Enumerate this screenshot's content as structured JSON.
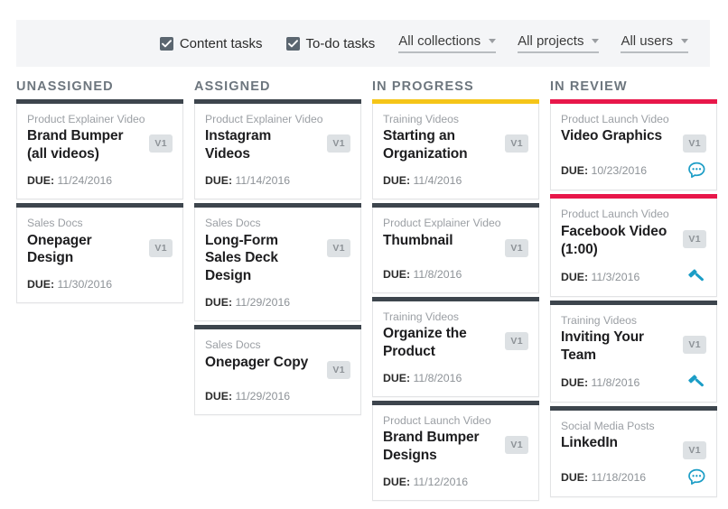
{
  "toolbar": {
    "checkboxes": [
      {
        "label": "Content tasks",
        "checked": true
      },
      {
        "label": "To-do tasks",
        "checked": true
      }
    ],
    "dropdowns": [
      {
        "label": "All collections"
      },
      {
        "label": "All projects"
      },
      {
        "label": "All users"
      }
    ]
  },
  "colors": {
    "accent_slate": "#3d454d",
    "accent_yellow": "#f5c518",
    "accent_red": "#e8174a",
    "icon_teal": "#1b9dc6",
    "badge_bg": "#dde1e4",
    "toolbar_bg": "#f4f5f7"
  },
  "columns": [
    {
      "title": "UNASSIGNED",
      "cards": [
        {
          "collection": "Product Explainer Video",
          "title": "Brand Bumper (all videos)",
          "badge": "V1",
          "due_label": "DUE:",
          "due_date": "11/24/2016",
          "bar_color": "#3d454d",
          "icon": ""
        },
        {
          "collection": "Sales Docs",
          "title": "Onepager Design",
          "badge": "V1",
          "due_label": "DUE:",
          "due_date": "11/30/2016",
          "bar_color": "#3d454d",
          "icon": ""
        }
      ]
    },
    {
      "title": "ASSIGNED",
      "cards": [
        {
          "collection": "Product Explainer Video",
          "title": "Instagram Videos",
          "badge": "V1",
          "due_label": "DUE:",
          "due_date": "11/14/2016",
          "bar_color": "#3d454d",
          "icon": ""
        },
        {
          "collection": "Sales Docs",
          "title": "Long-Form Sales Deck Design",
          "badge": "V1",
          "due_label": "DUE:",
          "due_date": "11/29/2016",
          "bar_color": "#3d454d",
          "icon": ""
        },
        {
          "collection": "Sales Docs",
          "title": "Onepager Copy",
          "badge": "V1",
          "due_label": "DUE:",
          "due_date": "11/29/2016",
          "bar_color": "#3d454d",
          "icon": ""
        }
      ]
    },
    {
      "title": "IN PROGRESS",
      "cards": [
        {
          "collection": "Training Videos",
          "title": "Starting an Organization",
          "badge": "V1",
          "due_label": "DUE:",
          "due_date": "11/4/2016",
          "bar_color": "#f5c518",
          "icon": ""
        },
        {
          "collection": "Product Explainer Video",
          "title": "Thumbnail",
          "badge": "V1",
          "due_label": "DUE:",
          "due_date": "11/8/2016",
          "bar_color": "#3d454d",
          "icon": ""
        },
        {
          "collection": "Training Videos",
          "title": "Organize the Product",
          "badge": "V1",
          "due_label": "DUE:",
          "due_date": "11/8/2016",
          "bar_color": "#3d454d",
          "icon": ""
        },
        {
          "collection": "Product Launch Video",
          "title": "Brand Bumper Designs",
          "badge": "V1",
          "due_label": "DUE:",
          "due_date": "11/12/2016",
          "bar_color": "#3d454d",
          "icon": ""
        }
      ]
    },
    {
      "title": "IN REVIEW",
      "cards": [
        {
          "collection": "Product Launch Video",
          "title": "Video Graphics",
          "badge": "V1",
          "due_label": "DUE:",
          "due_date": "10/23/2016",
          "bar_color": "#e8174a",
          "icon": "comment-icon"
        },
        {
          "collection": "Product Launch Video",
          "title": "Facebook Video (1:00)",
          "badge": "V1",
          "due_label": "DUE:",
          "due_date": "11/3/2016",
          "bar_color": "#e8174a",
          "icon": "gavel-icon"
        },
        {
          "collection": "Training Videos",
          "title": "Inviting Your Team",
          "badge": "V1",
          "due_label": "DUE:",
          "due_date": "11/8/2016",
          "bar_color": "#3d454d",
          "icon": "gavel-icon"
        },
        {
          "collection": "Social Media Posts",
          "title": "LinkedIn",
          "badge": "V1",
          "due_label": "DUE:",
          "due_date": "11/18/2016",
          "bar_color": "#3d454d",
          "icon": "comment-icon"
        }
      ]
    }
  ]
}
